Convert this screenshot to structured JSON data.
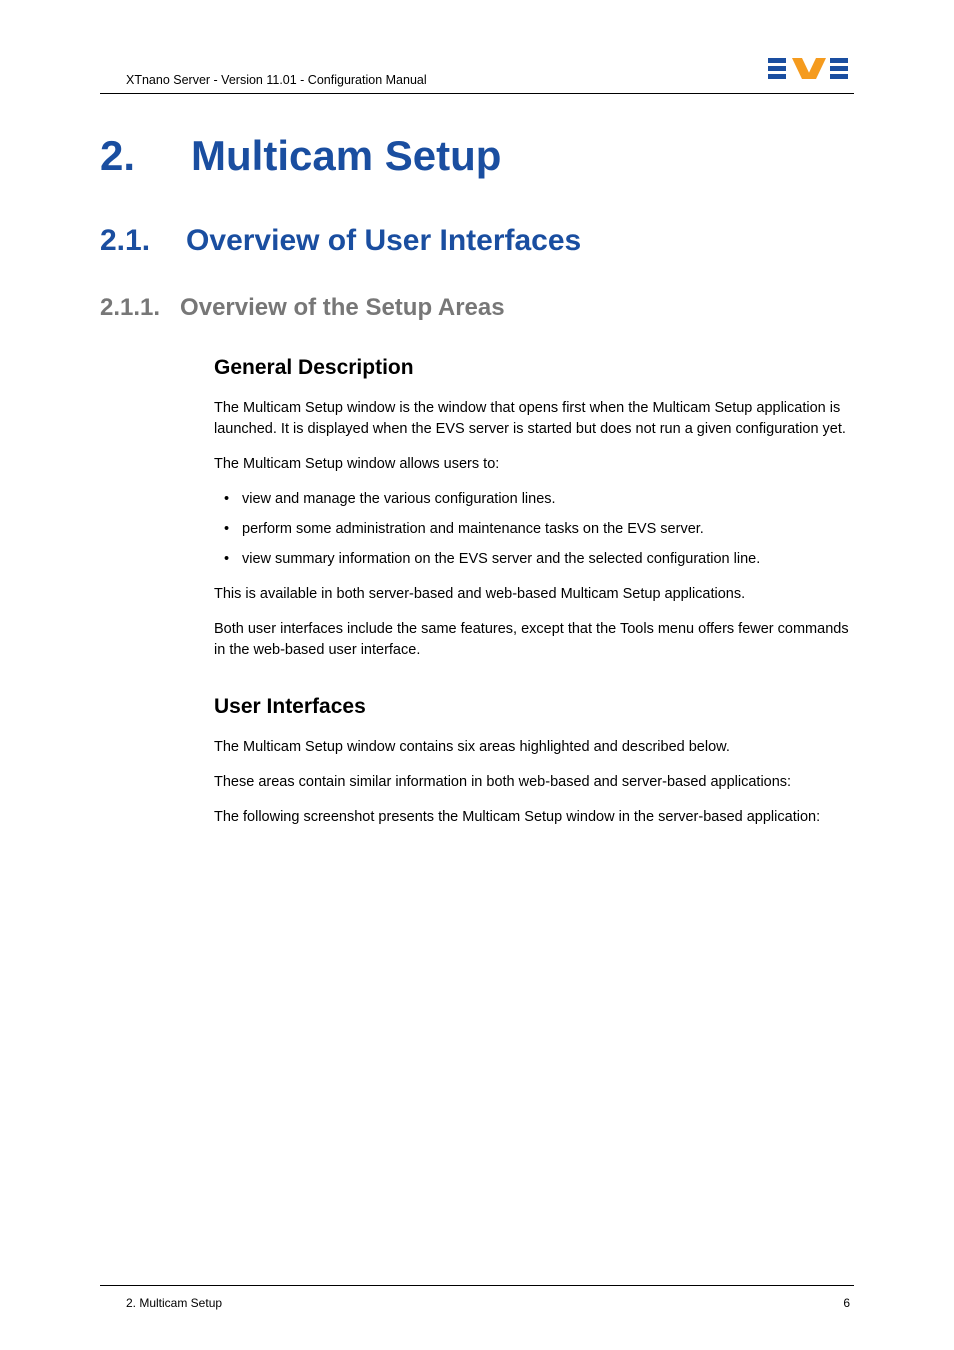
{
  "header": {
    "breadcrumb": "XTnano Server - Version 11.01 - Configuration Manual"
  },
  "logo": {
    "colors": {
      "blue": "#1a4ea0",
      "orange": "#f59b1e"
    }
  },
  "h1": {
    "num": "2.",
    "title": "Multicam Setup"
  },
  "h2": {
    "num": "2.1.",
    "title": "Overview of User Interfaces"
  },
  "h3": {
    "num": "2.1.1.",
    "title": "Overview of the Setup Areas"
  },
  "section_gd": {
    "heading": "General Description",
    "p1": "The Multicam Setup window is the window that opens first when the Multicam Setup application is launched. It is displayed when the EVS server is started but does not run a given configuration yet.",
    "p2": "The Multicam Setup window allows users to:",
    "bullets": [
      "view and manage the various configuration lines.",
      "perform some administration and maintenance tasks on the EVS server.",
      "view summary information on the EVS server and the selected configuration line."
    ],
    "p3": "This is available in both server-based and web-based Multicam Setup applications.",
    "p4": "Both user interfaces include the same features, except that the Tools menu offers fewer commands in the web-based user interface."
  },
  "section_ui": {
    "heading": "User Interfaces",
    "p1": "The Multicam Setup window contains six areas highlighted and described below.",
    "p2": "These areas contain similar information in both web-based and server-based applications:",
    "p3": "The following screenshot presents the Multicam Setup window in the server-based application:"
  },
  "footer": {
    "left": "2. Multicam Setup",
    "right": "6"
  }
}
